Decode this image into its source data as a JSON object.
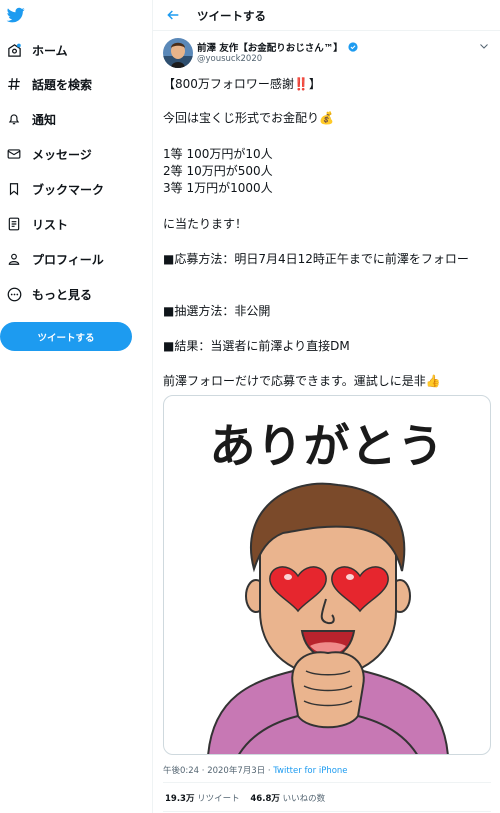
{
  "sidebar": {
    "logo": "twitter-bird-icon",
    "items": [
      {
        "label": "ホーム",
        "icon": "home-icon"
      },
      {
        "label": "話題を検索",
        "icon": "hashtag-icon"
      },
      {
        "label": "通知",
        "icon": "bell-icon"
      },
      {
        "label": "メッセージ",
        "icon": "mail-icon"
      },
      {
        "label": "ブックマーク",
        "icon": "bookmark-icon"
      },
      {
        "label": "リスト",
        "icon": "list-icon"
      },
      {
        "label": "プロフィール",
        "icon": "person-icon"
      },
      {
        "label": "もっと見る",
        "icon": "more-icon"
      }
    ],
    "tweet_button": "ツイートする"
  },
  "header": {
    "title": "ツイートする"
  },
  "tweet": {
    "author_name": "前澤 友作【お金配りおじさん™】",
    "author_handle": "@yousuck2020",
    "lines": {
      "l1": "【800万フォロワー感謝‼️】",
      "l2": "今回は宝くじ形式でお金配り💰",
      "l3": "1等 100万円が10人",
      "l4": "2等 10万円が500人",
      "l5": "3等 1万円が1000人",
      "l6": "に当たります！",
      "l7": "■応募方法：明日7月4日12時正午までに前澤をフォロー",
      "l8": "■抽選方法：非公開",
      "l9": "■結果：当選者に前澤より直接DM",
      "l10": "前澤フォローだけで応募できます。運試しに是非👍"
    },
    "media_caption": "ありがとう",
    "timestamp": "午後0:24 · 2020年7月3日 · ",
    "source": "Twitter for iPhone",
    "retweets_count": "19.3万",
    "retweets_label": " リツイート",
    "likes_count": "46.8万",
    "likes_label": " いいねの数"
  },
  "colors": {
    "accent": "#1d9bf0",
    "text": "#0f1419",
    "secondary": "#536471",
    "border": "#eff3f4"
  }
}
